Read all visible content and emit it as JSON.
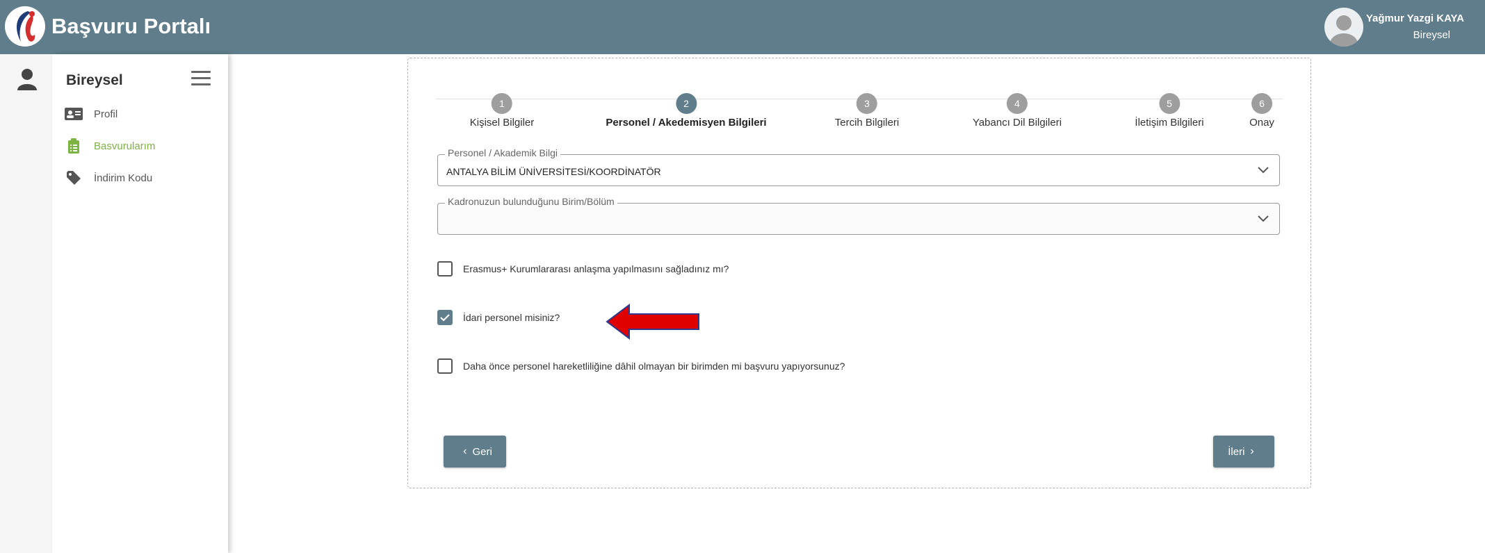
{
  "header": {
    "brand": "Başvuru Portalı",
    "user_name": "Yağmur Yazgi KAYA",
    "user_role": "Bireysel"
  },
  "sidebar": {
    "title": "Bireysel",
    "items": [
      {
        "label": "Profil",
        "icon": "id-card-icon"
      },
      {
        "label": "Basvurularım",
        "icon": "clipboard-list-icon",
        "active": true
      },
      {
        "label": "İndirim Kodu",
        "icon": "tag-icon"
      }
    ]
  },
  "stepper": {
    "steps": [
      {
        "number": "1",
        "label": "Kişisel Bilgiler"
      },
      {
        "number": "2",
        "label": "Personel / Akedemisyen Bilgileri",
        "active": true
      },
      {
        "number": "3",
        "label": "Tercih Bilgileri"
      },
      {
        "number": "4",
        "label": "Yabancı Dil Bilgileri"
      },
      {
        "number": "5",
        "label": "İletişim Bilgileri"
      },
      {
        "number": "6",
        "label": "Onay"
      }
    ]
  },
  "form": {
    "field1": {
      "label": "Personel / Akademik Bilgi",
      "value": "ANTALYA BİLİM ÜNİVERSİTESİ/KOORDİNATÖR"
    },
    "field2": {
      "label": "Kadronuzun bulunduğunu Birim/Bölüm",
      "value": ""
    },
    "checkboxes": [
      {
        "label": "Erasmus+ Kurumlararası anlaşma yapılmasını sağladınız mı?",
        "checked": false
      },
      {
        "label": "İdari personel misiniz?",
        "checked": true
      },
      {
        "label": "Daha önce personel hareketliliğine dâhil olmayan bir birimden mi başvuru yapıyorsunuz?",
        "checked": false
      }
    ],
    "back_label": "Geri",
    "next_label": "İleri"
  },
  "colors": {
    "primary": "#607d8b",
    "active_link": "#7cb342",
    "arrow": "#e00000"
  }
}
